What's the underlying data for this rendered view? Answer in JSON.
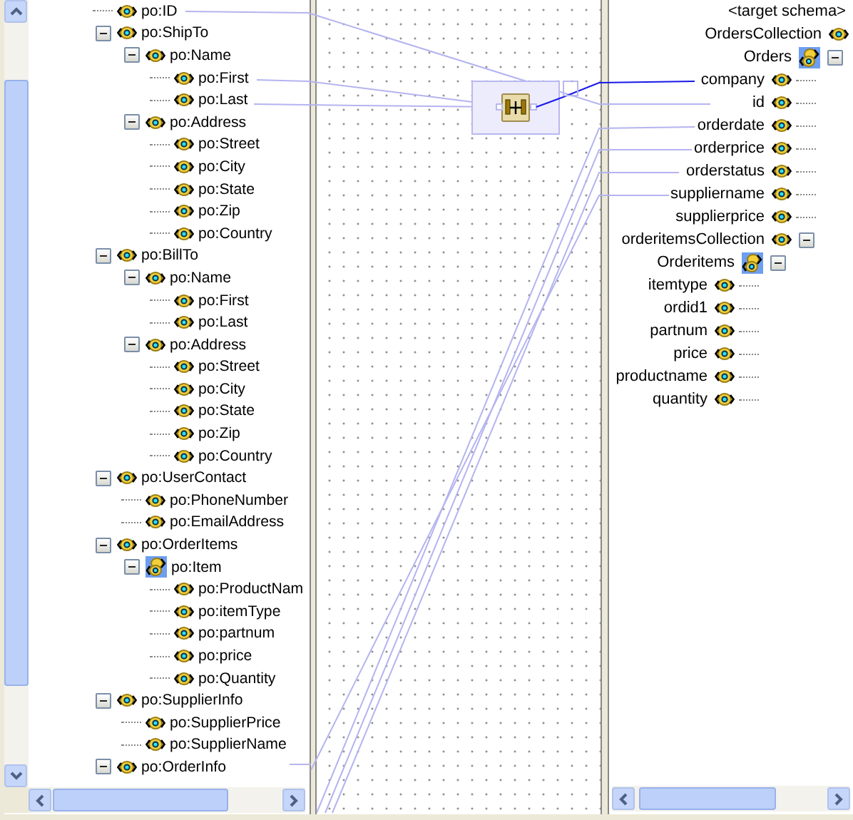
{
  "left_tree": [
    {
      "label": "po:ID",
      "kind": "element"
    },
    {
      "label": "po:ShipTo",
      "kind": "element",
      "expanded": true,
      "children": [
        {
          "label": "po:Name",
          "kind": "element",
          "expanded": true,
          "children": [
            {
              "label": "po:First",
              "kind": "element"
            },
            {
              "label": "po:Last",
              "kind": "element"
            }
          ]
        },
        {
          "label": "po:Address",
          "kind": "element",
          "expanded": true,
          "children": [
            {
              "label": "po:Street",
              "kind": "element"
            },
            {
              "label": "po:City",
              "kind": "element"
            },
            {
              "label": "po:State",
              "kind": "element"
            },
            {
              "label": "po:Zip",
              "kind": "element"
            },
            {
              "label": "po:Country",
              "kind": "element"
            }
          ]
        }
      ]
    },
    {
      "label": "po:BillTo",
      "kind": "element",
      "expanded": true,
      "children": [
        {
          "label": "po:Name",
          "kind": "element",
          "expanded": true,
          "children": [
            {
              "label": "po:First",
              "kind": "element"
            },
            {
              "label": "po:Last",
              "kind": "element"
            }
          ]
        },
        {
          "label": "po:Address",
          "kind": "element",
          "expanded": true,
          "children": [
            {
              "label": "po:Street",
              "kind": "element"
            },
            {
              "label": "po:City",
              "kind": "element"
            },
            {
              "label": "po:State",
              "kind": "element"
            },
            {
              "label": "po:Zip",
              "kind": "element"
            },
            {
              "label": "po:Country",
              "kind": "element"
            }
          ]
        }
      ]
    },
    {
      "label": "po:UserContact",
      "kind": "element",
      "expanded": true,
      "children": [
        {
          "label": "po:PhoneNumber",
          "kind": "element"
        },
        {
          "label": "po:EmailAddress",
          "kind": "element"
        }
      ]
    },
    {
      "label": "po:OrderItems",
      "kind": "element",
      "expanded": true,
      "children": [
        {
          "label": "po:Item",
          "kind": "repeating",
          "expanded": true,
          "children": [
            {
              "label": "po:ProductNam",
              "kind": "element"
            },
            {
              "label": "po:itemType",
              "kind": "element"
            },
            {
              "label": "po:partnum",
              "kind": "element"
            },
            {
              "label": "po:price",
              "kind": "element"
            },
            {
              "label": "po:Quantity",
              "kind": "element"
            }
          ]
        }
      ]
    },
    {
      "label": "po:SupplierInfo",
      "kind": "element",
      "expanded": true,
      "children": [
        {
          "label": "po:SupplierPrice",
          "kind": "element"
        },
        {
          "label": "po:SupplierName",
          "kind": "element"
        }
      ]
    },
    {
      "label": "po:OrderInfo",
      "kind": "element",
      "expanded": true
    }
  ],
  "right_tree": {
    "header": "<target schema>",
    "nodes": [
      {
        "label": "OrdersCollection",
        "kind": "element",
        "children": [
          {
            "label": "Orders",
            "kind": "repeating",
            "expanded": true,
            "children": [
              {
                "label": "company",
                "kind": "element"
              },
              {
                "label": "id",
                "kind": "element"
              },
              {
                "label": "orderdate",
                "kind": "element"
              },
              {
                "label": "orderprice",
                "kind": "element"
              },
              {
                "label": "orderstatus",
                "kind": "element"
              },
              {
                "label": "suppliername",
                "kind": "element"
              },
              {
                "label": "supplierprice",
                "kind": "element"
              },
              {
                "label": "orderitemsCollection",
                "kind": "element",
                "expanded": true,
                "children": [
                  {
                    "label": "Orderitems",
                    "kind": "repeating",
                    "expanded": true,
                    "children": [
                      {
                        "label": "itemtype",
                        "kind": "element"
                      },
                      {
                        "label": "ordid1",
                        "kind": "element"
                      },
                      {
                        "label": "partnum",
                        "kind": "element"
                      },
                      {
                        "label": "price",
                        "kind": "element"
                      },
                      {
                        "label": "productname",
                        "kind": "element"
                      },
                      {
                        "label": "quantity",
                        "kind": "element"
                      }
                    ]
                  }
                ]
              }
            ]
          }
        ]
      }
    ]
  }
}
